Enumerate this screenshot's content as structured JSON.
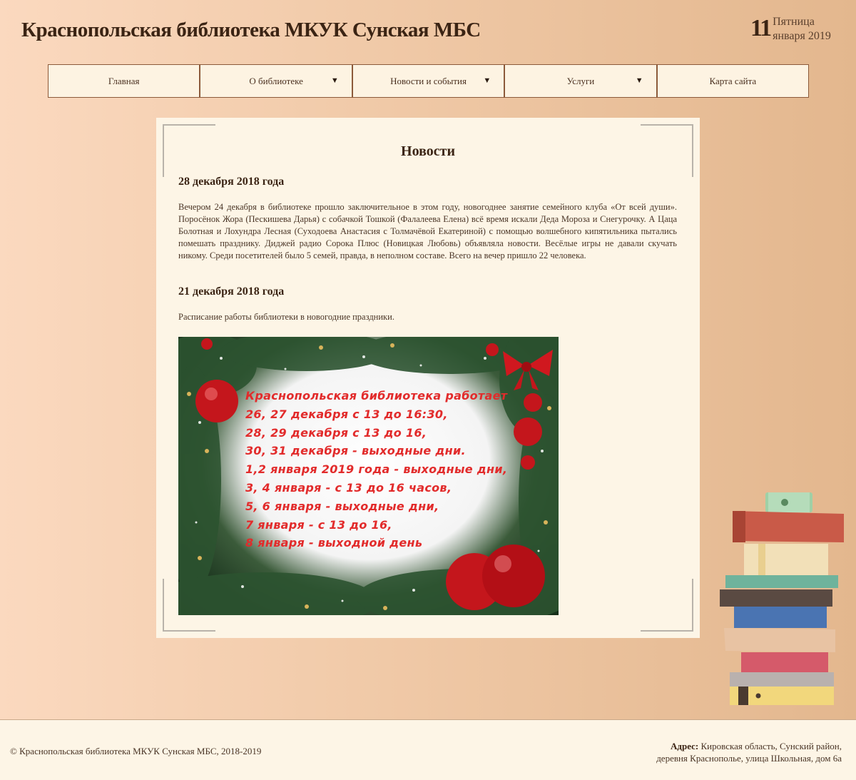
{
  "header": {
    "site_title": "Краснопольская библиотека МКУК Сунская МБС",
    "date_day": "11",
    "date_weekday": "Пятница",
    "date_month_year": "января 2019"
  },
  "nav": {
    "items": [
      {
        "label": "Главная",
        "has_dropdown": false
      },
      {
        "label": "О библиотеке",
        "has_dropdown": true
      },
      {
        "label": "Новости и события",
        "has_dropdown": true
      },
      {
        "label": "Услуги",
        "has_dropdown": true
      },
      {
        "label": "Карта сайта",
        "has_dropdown": false
      }
    ],
    "dropdown_glyph": "▼"
  },
  "main": {
    "title": "Новости",
    "news": [
      {
        "date": "28 декабря 2018 года",
        "text": "Вечером 24 декабря в библиотеке прошло заключительное в этом году, новогоднее занятие семейного клуба «От всей души». Поросёнок Жора (Пескишева Дарья) с собачкой Тошкой (Фалалеева Елена) всё время искали Деда Мороза и Снегурочку. А Цаца Болотная и Лохундра Лесная (Суходоева Анастасия с Толмачёвой Екатериной) с помощью волшебного кипятильника пытались помешать празднику. Диджей радио Сорока Плюс (Новицкая Любовь) объявляла новости. Весёлые игры не давали скучать никому. Среди посетителей было 5 семей, правда, в неполном составе. Всего на вечер пришло 22 человека."
      },
      {
        "date": "21 декабря 2018 года",
        "text": "Расписание работы библиотеки в новогодние праздники."
      }
    ],
    "holiday_image": {
      "lines": [
        "Краснопольская библиотека работает",
        "26, 27 декабря с 13 до 16:30,",
        "28, 29 декабря с 13 до 16,",
        "30, 31 декабря - выходные дни.",
        "1,2 января 2019 года - выходные дни,",
        "3, 4 января - с 13 до 16 часов,",
        "5, 6 января - выходные дни,",
        "7 января - с 13 до 16,",
        "8 января - выходной день"
      ]
    }
  },
  "footer": {
    "copyright": "© Краснопольская библиотека МКУК Сунская МБС, 2018-2019",
    "address_label": "Адрес:",
    "address_line1": "Кировская область, Сунский район,",
    "address_line2": "деревня Краснополье, улица Школьная, дом 6а"
  },
  "colors": {
    "panel_bg": "#fdf5e6",
    "nav_border": "#8c5a3a",
    "holiday_text": "#e22b2b"
  }
}
